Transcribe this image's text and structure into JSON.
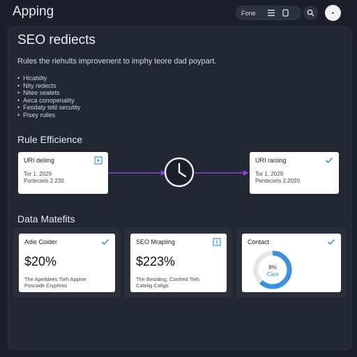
{
  "app": {
    "title": "Apping"
  },
  "topbar": {
    "action_label": "Fone",
    "avatar_label": "•"
  },
  "page": {
    "title": "SEO rediects",
    "description": "Rules the riehults improvenent to imphy teore dad poypart.",
    "bullets": [
      "Hicabilty",
      "Nity redects",
      "Nitee seatets",
      "Aeca conopenality",
      "Feodaty tetil secutity",
      "Pisey ruiles"
    ]
  },
  "rule_section": {
    "title": "Rule Efficience",
    "left_card": {
      "title": "URI deliing",
      "line1": "Tor 1. 2029",
      "line2": "Porteciets 2.230"
    },
    "right_card": {
      "title": "URI raising",
      "line1": "Tor 1. 2029",
      "line2": "Penteciets 2.2020"
    }
  },
  "metrics_section": {
    "title": "Data Matefits",
    "cards": [
      {
        "title": "Adie Coider",
        "value": "$20%",
        "desc1": "The Apelidees Tieh Appine",
        "desc2": "Poscade Cryphms"
      },
      {
        "title": "SEO Mrapling",
        "value": "$223%",
        "desc1": "The Besiding, Confred Tieh",
        "desc2": "Catelig Cafigs"
      },
      {
        "title": "Contact",
        "gauge_value": "8%",
        "gauge_label": "Care",
        "gauge_fraction": 0.62
      }
    ]
  },
  "colors": {
    "accent": "#3d8fe0",
    "arrow": "#8a3fe0",
    "panel": "#222734",
    "bg": "#1b1f2a"
  }
}
